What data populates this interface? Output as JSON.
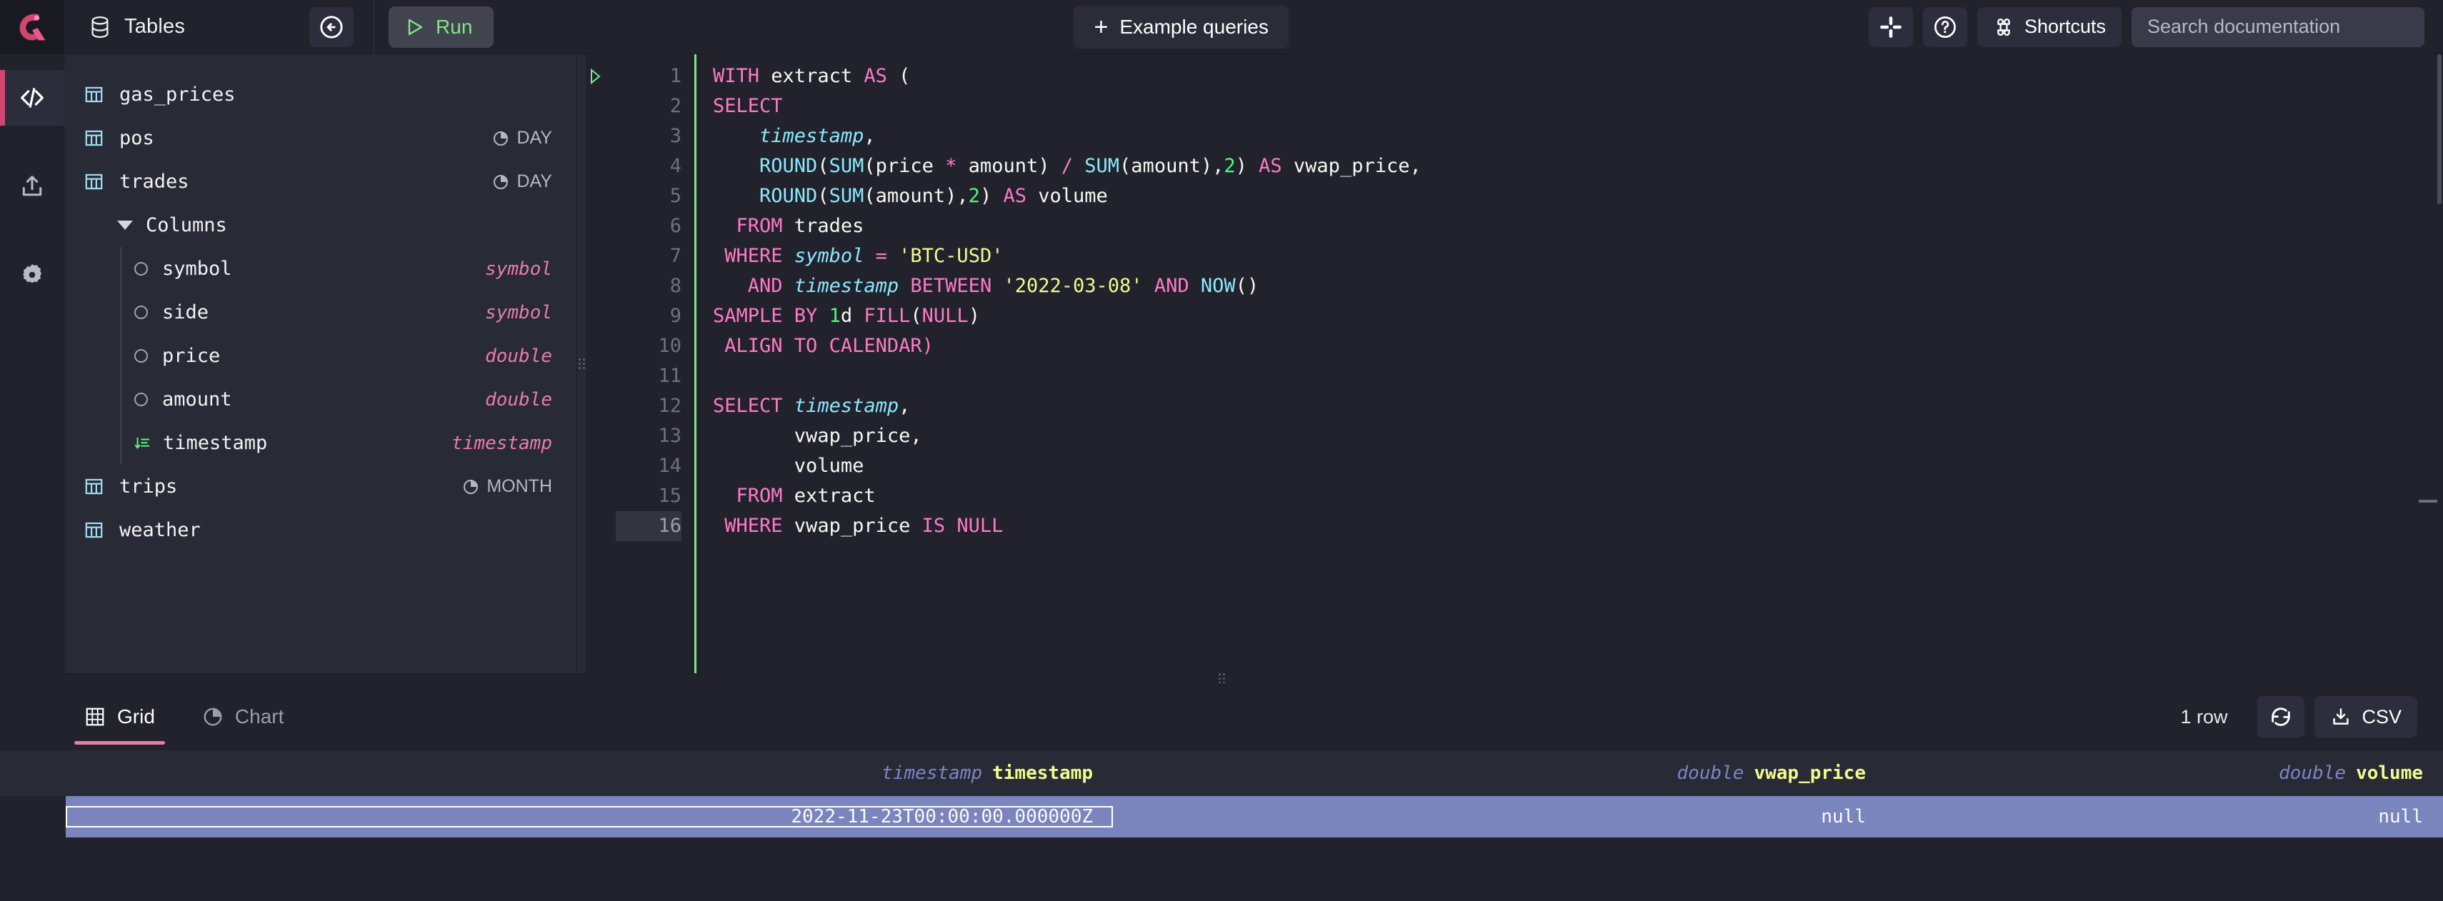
{
  "app": {
    "logo_color": "#d14671",
    "accent_pink": "#e87ca7",
    "accent_green": "#7ee787",
    "bg": "#21222c",
    "panel_bg": "#282a36"
  },
  "topbar": {
    "tables_label": "Tables",
    "tables_icon": "database-icon",
    "collapse_icon": "collapse-panel-icon",
    "run_label": "Run",
    "run_icon": "play-triangle-icon",
    "example_queries_label": "Example queries",
    "example_queries_icon": "plus-icon",
    "slack_icon": "slack-icon",
    "help_icon": "question-circle-icon",
    "shortcuts_label": "Shortcuts",
    "shortcuts_icon": "command-icon",
    "search_placeholder": "Search documentation"
  },
  "rail": {
    "items": [
      {
        "name": "code-icon",
        "label": "Console",
        "active": true
      },
      {
        "name": "upload-icon",
        "label": "Import",
        "active": false
      },
      {
        "name": "gear-icon",
        "label": "Settings",
        "active": false
      }
    ]
  },
  "schema": {
    "tables": [
      {
        "name": "gas_prices",
        "partition": "",
        "icon": "table-icon",
        "expanded": false
      },
      {
        "name": "pos",
        "partition": "DAY",
        "icon": "table-icon",
        "expanded": false
      },
      {
        "name": "trades",
        "partition": "DAY",
        "icon": "table-icon",
        "expanded": true
      },
      {
        "name": "trips",
        "partition": "MONTH",
        "icon": "table-icon",
        "expanded": false
      },
      {
        "name": "weather",
        "partition": "",
        "icon": "table-icon",
        "expanded": false
      }
    ],
    "columns_group_label": "Columns",
    "columns": [
      {
        "name": "symbol",
        "type": "symbol",
        "icon": "column-dot-icon"
      },
      {
        "name": "side",
        "type": "symbol",
        "icon": "column-dot-icon"
      },
      {
        "name": "price",
        "type": "double",
        "icon": "column-dot-icon"
      },
      {
        "name": "amount",
        "type": "double",
        "icon": "column-dot-icon"
      },
      {
        "name": "timestamp",
        "type": "timestamp",
        "icon": "designated-timestamp-icon"
      }
    ]
  },
  "editor": {
    "active_line": 16,
    "lines": [
      {
        "n": 1,
        "tokens": [
          {
            "t": "WITH",
            "c": "kw"
          },
          {
            "t": " "
          },
          {
            "t": "extract",
            "c": "id"
          },
          {
            "t": " "
          },
          {
            "t": "AS",
            "c": "kw"
          },
          {
            "t": " ("
          }
        ]
      },
      {
        "n": 2,
        "tokens": [
          {
            "t": "SELECT",
            "c": "kw"
          }
        ]
      },
      {
        "n": 3,
        "tokens": [
          {
            "t": "    "
          },
          {
            "t": "timestamp",
            "c": "idi"
          },
          {
            "t": ","
          }
        ]
      },
      {
        "n": 4,
        "tokens": [
          {
            "t": "    "
          },
          {
            "t": "ROUND",
            "c": "fn"
          },
          {
            "t": "("
          },
          {
            "t": "SUM",
            "c": "fn"
          },
          {
            "t": "(price "
          },
          {
            "t": "*",
            "c": "op"
          },
          {
            "t": " amount) "
          },
          {
            "t": "/",
            "c": "op"
          },
          {
            "t": " "
          },
          {
            "t": "SUM",
            "c": "fn"
          },
          {
            "t": "(amount),"
          },
          {
            "t": "2",
            "c": "num"
          },
          {
            "t": ") "
          },
          {
            "t": "AS",
            "c": "kw"
          },
          {
            "t": " vwap_price,"
          }
        ]
      },
      {
        "n": 5,
        "tokens": [
          {
            "t": "    "
          },
          {
            "t": "ROUND",
            "c": "fn"
          },
          {
            "t": "("
          },
          {
            "t": "SUM",
            "c": "fn"
          },
          {
            "t": "(amount),"
          },
          {
            "t": "2",
            "c": "num"
          },
          {
            "t": ") "
          },
          {
            "t": "AS",
            "c": "kw"
          },
          {
            "t": " volume"
          }
        ]
      },
      {
        "n": 6,
        "tokens": [
          {
            "t": "  "
          },
          {
            "t": "FROM",
            "c": "kw"
          },
          {
            "t": " trades"
          }
        ]
      },
      {
        "n": 7,
        "tokens": [
          {
            "t": " "
          },
          {
            "t": "WHERE",
            "c": "kw"
          },
          {
            "t": " "
          },
          {
            "t": "symbol",
            "c": "idi"
          },
          {
            "t": " "
          },
          {
            "t": "=",
            "c": "op"
          },
          {
            "t": " "
          },
          {
            "t": "'BTC-USD'",
            "c": "str"
          }
        ]
      },
      {
        "n": 8,
        "tokens": [
          {
            "t": "   "
          },
          {
            "t": "AND",
            "c": "kw"
          },
          {
            "t": " "
          },
          {
            "t": "timestamp",
            "c": "idi"
          },
          {
            "t": " "
          },
          {
            "t": "BETWEEN",
            "c": "kw"
          },
          {
            "t": " "
          },
          {
            "t": "'2022-03-08'",
            "c": "str"
          },
          {
            "t": " "
          },
          {
            "t": "AND",
            "c": "kw"
          },
          {
            "t": " "
          },
          {
            "t": "NOW",
            "c": "fn"
          },
          {
            "t": "()"
          }
        ]
      },
      {
        "n": 9,
        "tokens": [
          {
            "t": "SAMPLE BY",
            "c": "kw"
          },
          {
            "t": " "
          },
          {
            "t": "1",
            "c": "num"
          },
          {
            "t": "d "
          },
          {
            "t": "FILL",
            "c": "kw"
          },
          {
            "t": "("
          },
          {
            "t": "NULL",
            "c": "kw"
          },
          {
            "t": ")"
          }
        ]
      },
      {
        "n": 10,
        "tokens": [
          {
            "t": " "
          },
          {
            "t": "ALIGN TO CALENDAR",
            "c": "kw"
          },
          {
            "t": ")",
            "c": "kw"
          }
        ]
      },
      {
        "n": 11,
        "tokens": []
      },
      {
        "n": 12,
        "tokens": [
          {
            "t": "SELECT",
            "c": "kw"
          },
          {
            "t": " "
          },
          {
            "t": "timestamp",
            "c": "idi"
          },
          {
            "t": ","
          }
        ]
      },
      {
        "n": 13,
        "tokens": [
          {
            "t": "       "
          },
          {
            "t": "vwap_price,"
          }
        ]
      },
      {
        "n": 14,
        "tokens": [
          {
            "t": "       "
          },
          {
            "t": "volume"
          }
        ]
      },
      {
        "n": 15,
        "tokens": [
          {
            "t": "  "
          },
          {
            "t": "FROM",
            "c": "kw"
          },
          {
            "t": " extract"
          }
        ]
      },
      {
        "n": 16,
        "tokens": [
          {
            "t": " "
          },
          {
            "t": "WHERE",
            "c": "kw"
          },
          {
            "t": " vwap_price "
          },
          {
            "t": "IS NULL",
            "c": "kw"
          }
        ]
      }
    ]
  },
  "results": {
    "tabs": [
      {
        "label": "Grid",
        "icon": "grid-icon",
        "active": true
      },
      {
        "label": "Chart",
        "icon": "pie-chart-icon",
        "active": false
      }
    ],
    "row_count_label": "1 row",
    "refresh_icon": "refresh-icon",
    "csv_label": "CSV",
    "csv_icon": "download-icon",
    "grid": {
      "columns": [
        {
          "name": "timestamp",
          "type": "timestamp"
        },
        {
          "name": "vwap_price",
          "type": "double"
        },
        {
          "name": "volume",
          "type": "double"
        }
      ],
      "rows": [
        {
          "cells": [
            "2022-11-23T00:00:00.000000Z",
            "null",
            "null"
          ],
          "selected_cell": 0
        }
      ]
    }
  }
}
